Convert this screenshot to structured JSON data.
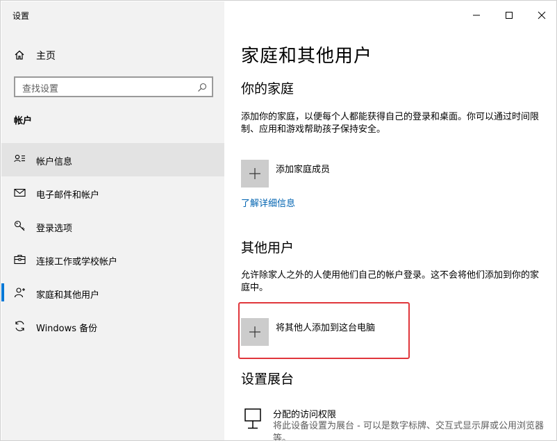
{
  "window": {
    "title": "设置",
    "controls": {
      "minimize": "minimize-icon",
      "maximize": "maximize-icon",
      "close": "close-icon"
    }
  },
  "sidebar": {
    "home_label": "主页",
    "search_placeholder": "查找设置",
    "section_title": "帐户",
    "items": [
      {
        "label": "帐户信息",
        "icon": "account-info-icon",
        "selected": true
      },
      {
        "label": "电子邮件和帐户",
        "icon": "mail-icon",
        "selected": false
      },
      {
        "label": "登录选项",
        "icon": "key-icon",
        "selected": false
      },
      {
        "label": "连接工作或学校帐户",
        "icon": "briefcase-icon",
        "selected": false
      },
      {
        "label": "家庭和其他用户",
        "icon": "add-person-icon",
        "selected": false,
        "active_indicator": true
      },
      {
        "label": "Windows 备份",
        "icon": "sync-icon",
        "selected": false
      }
    ]
  },
  "main": {
    "page_title": "家庭和其他用户",
    "family": {
      "heading": "你的家庭",
      "description": "添加你的家庭，以便每个人都能获得自己的登录和桌面。你可以通过时间限制、应用和游戏帮助孩子保持安全。",
      "add_label": "添加家庭成员",
      "learn_more": "了解详细信息"
    },
    "others": {
      "heading": "其他用户",
      "description": "允许除家人之外的人使用他们自己的帐户登录。这不会将他们添加到你的家庭中。",
      "add_label": "将其他人添加到这台电脑"
    },
    "kiosk": {
      "heading": "设置展台",
      "title": "分配的访问权限",
      "description": "将此设备设置为展台 - 可以是数字标牌、交互式显示屏或公用浏览器等。"
    }
  },
  "colors": {
    "accent": "#0078d7",
    "link": "#0063b1",
    "highlight_border": "#e0363b",
    "sidebar_bg": "#f2f2f2"
  }
}
